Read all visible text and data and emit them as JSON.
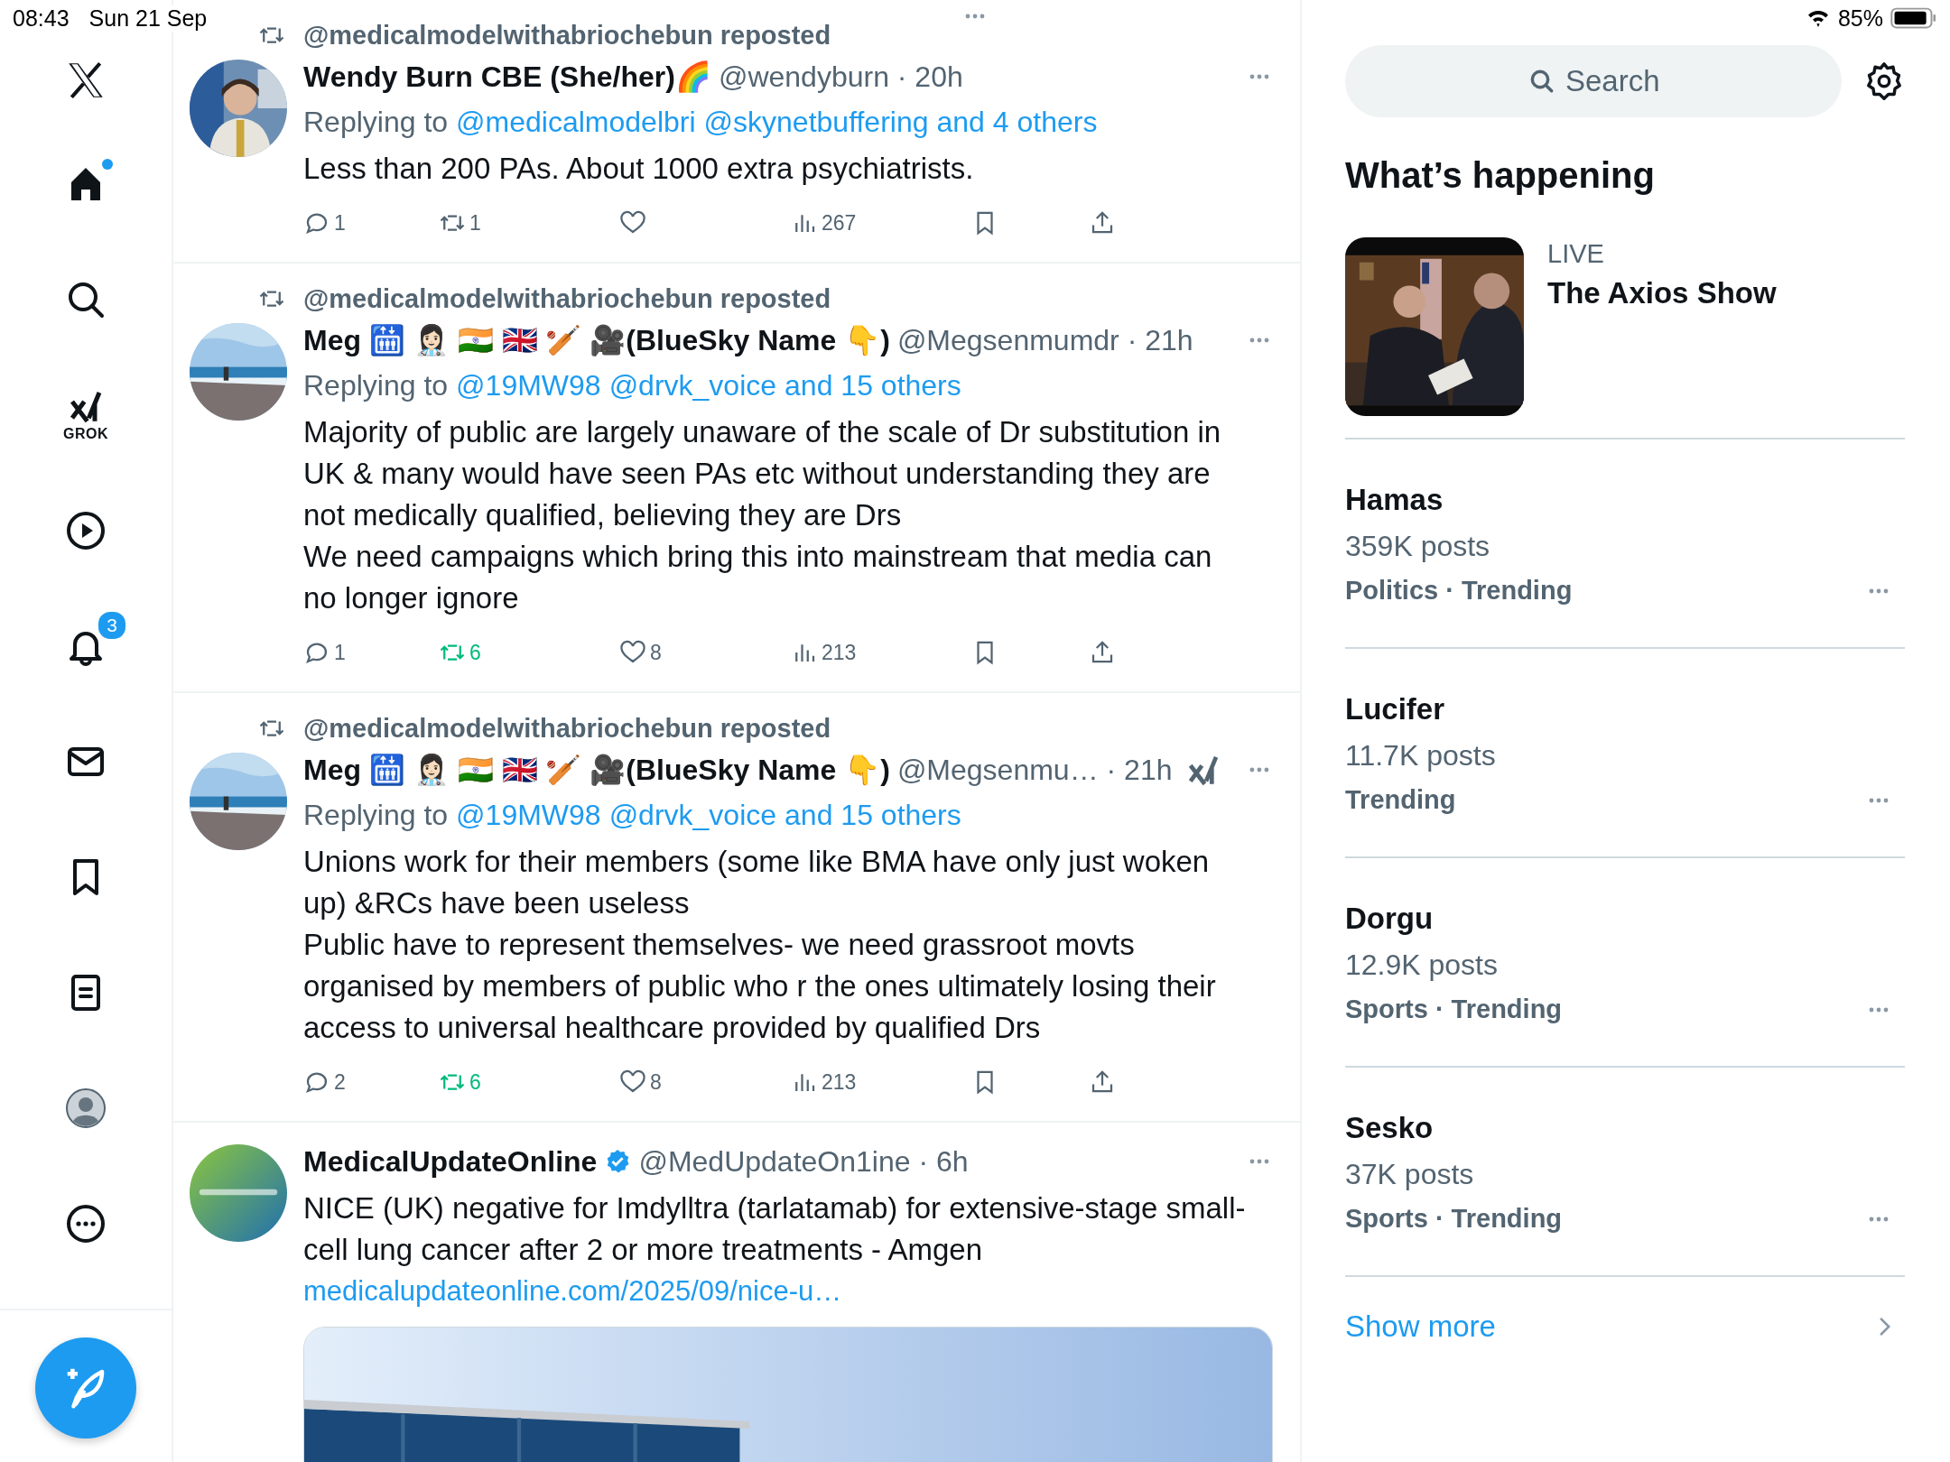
{
  "status_bar": {
    "time": "08:43",
    "date": "Sun 21 Sep",
    "battery": "85%"
  },
  "nav": {
    "items": [
      {
        "kind": "home",
        "selected": true,
        "unread_dot": true
      },
      {
        "kind": "search",
        "selected": false,
        "unread_dot": false
      },
      {
        "kind": "grok",
        "label": "GROK",
        "selected": false,
        "unread_dot": false
      },
      {
        "kind": "video",
        "selected": false,
        "unread_dot": false
      },
      {
        "kind": "notifications",
        "badge": "3",
        "selected": false,
        "unread_dot": false
      },
      {
        "kind": "messages",
        "selected": false,
        "unread_dot": false
      },
      {
        "kind": "bookmarks",
        "selected": false,
        "unread_dot": false
      },
      {
        "kind": "lists",
        "selected": false,
        "unread_dot": false
      },
      {
        "kind": "profile",
        "selected": false,
        "unread_dot": false
      },
      {
        "kind": "more",
        "selected": false,
        "unread_dot": false
      }
    ]
  },
  "tweets": [
    {
      "reposted_by": "@medicalmodelwithabriochebun reposted",
      "name": "Wendy Burn CBE (She/her)🌈",
      "verified": false,
      "meta": "@wendyburn · 20h",
      "grok_icon": false,
      "replying_label": "Replying to",
      "replying_links": [
        "@medicalmodelbri",
        "@skynetbuffering",
        "and 4 others"
      ],
      "paragraphs": [
        "Less than 200 PAs. About 1000 extra psychiatrists."
      ],
      "actions": [
        {
          "kind": "reply",
          "count": "1"
        },
        {
          "kind": "repost",
          "count": "1",
          "active": false
        },
        {
          "kind": "like",
          "active": false
        },
        {
          "kind": "views",
          "count": "267"
        },
        {
          "kind": "bookmark"
        },
        {
          "kind": "share"
        }
      ]
    },
    {
      "reposted_by": "@medicalmodelwithabriochebun reposted",
      "name": "Meg 🛗 👩🏻‍⚕️ 🇮🇳 🇬🇧 🏏 🎥(BlueSky Name 👇)",
      "verified": false,
      "meta": "@Megsenmumdr · 21h",
      "grok_icon": false,
      "replying_label": "Replying to",
      "replying_links": [
        "@19MW98",
        "@drvk_voice",
        "and 15 others"
      ],
      "paragraphs": [
        "Majority of public are largely unaware of the scale of Dr substitution in UK & many would have seen PAs etc without understanding they are not medically qualified, believing they are Drs",
        "We need campaigns which bring this into mainstream that media can no longer ignore"
      ],
      "actions": [
        {
          "kind": "reply",
          "count": "1"
        },
        {
          "kind": "repost",
          "count": "6",
          "active": true
        },
        {
          "kind": "like",
          "count": "8",
          "active": false
        },
        {
          "kind": "views",
          "count": "213"
        },
        {
          "kind": "bookmark"
        },
        {
          "kind": "share"
        }
      ]
    },
    {
      "reposted_by": "@medicalmodelwithabriochebun reposted",
      "name": "Meg 🛗 👩🏻‍⚕️ 🇮🇳 🇬🇧 🏏 🎥(BlueSky Name 👇)",
      "verified": false,
      "meta": "@Megsenmu… · 21h",
      "grok_icon": true,
      "replying_label": "Replying to",
      "replying_links": [
        "@19MW98",
        "@drvk_voice",
        "and 15 others"
      ],
      "paragraphs": [
        "Unions work for their members (some like BMA have only just woken up) &RCs have been useless",
        "Public have to represent themselves- we need grassroot movts organised by members of public who r the ones ultimately losing their access to universal healthcare provided by qualified Drs"
      ],
      "actions": [
        {
          "kind": "reply",
          "count": "2"
        },
        {
          "kind": "repost",
          "count": "6",
          "active": true
        },
        {
          "kind": "like",
          "count": "8",
          "active": false
        },
        {
          "kind": "views",
          "count": "213"
        },
        {
          "kind": "bookmark"
        },
        {
          "kind": "share"
        }
      ]
    },
    {
      "name": "MedicalUpdateOnline",
      "verified": true,
      "meta": "@MedUpdateOn1ine · 6h",
      "grok_icon": false,
      "paragraphs": [
        "NICE (UK) negative for Imdylltra (tarlatamab) for extensive-stage small-cell lung cancer after 2 or more treatments - Amgen"
      ],
      "link": "medicalupdateonline.com/2025/09/nice-u…",
      "media": {
        "kind": "picture"
      }
    }
  ],
  "sidebar": {
    "search": {
      "placeholder": "Search"
    },
    "heading": "What’s happening",
    "live": {
      "label": "LIVE",
      "title": "The Axios Show"
    },
    "trends": [
      {
        "name": "Hamas",
        "posts": "359K posts",
        "category": "Politics · Trending"
      },
      {
        "name": "Lucifer",
        "posts": "11.7K posts",
        "category": "Trending"
      },
      {
        "name": "Dorgu",
        "posts": "12.9K posts",
        "category": "Sports · Trending"
      },
      {
        "name": "Sesko",
        "posts": "37K posts",
        "category": "Sports · Trending"
      }
    ],
    "show_more": "Show more"
  }
}
